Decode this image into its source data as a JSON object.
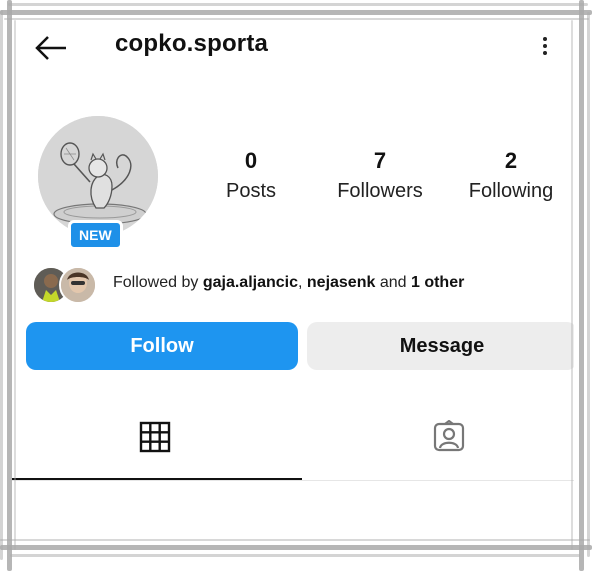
{
  "header": {
    "username": "copko.sporta",
    "back_icon": "arrow-left-icon",
    "menu_icon": "kebab-menu-icon"
  },
  "profile": {
    "badge": "NEW",
    "stats": [
      {
        "value": "0",
        "label": "Posts"
      },
      {
        "value": "7",
        "label": "Followers"
      },
      {
        "value": "2",
        "label": "Following"
      }
    ]
  },
  "followed_by": {
    "prefix": "Followed by ",
    "user1": "gaja.aljancic",
    "sep": ", ",
    "user2": "nejasenk",
    "and": " and ",
    "others": "1 other"
  },
  "actions": {
    "follow_label": "Follow",
    "message_label": "Message"
  },
  "tabs": [
    {
      "icon": "grid-icon",
      "active": true
    },
    {
      "icon": "tagged-person-icon",
      "active": false
    }
  ],
  "colors": {
    "accent": "#1e95f0",
    "badge": "#1e90e8",
    "secondary_button": "#ededed"
  }
}
